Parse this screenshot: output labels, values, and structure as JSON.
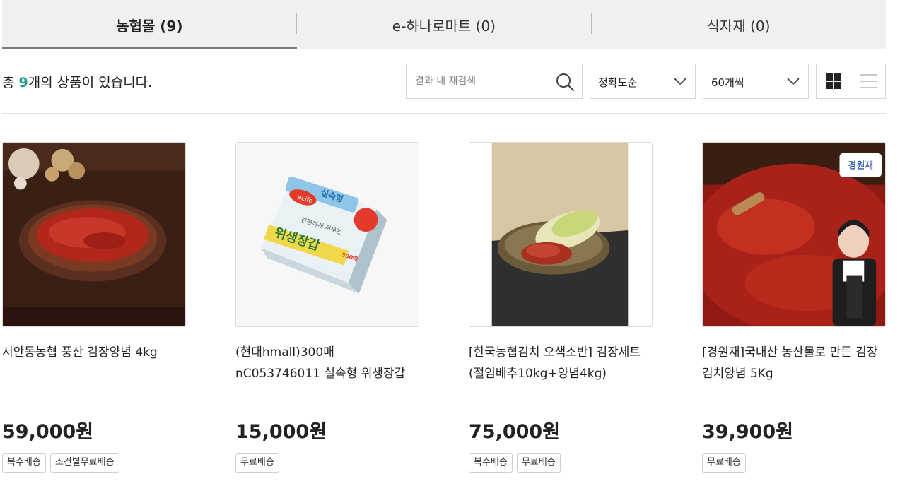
{
  "tabs": [
    {
      "label": "농협몰 (9)",
      "active": true
    },
    {
      "label": "e-하나로마트 (0)",
      "active": false
    },
    {
      "label": "식자재 (0)",
      "active": false
    }
  ],
  "result": {
    "prefix": "총 ",
    "count": "9",
    "suffix": "개의 상품이 있습니다."
  },
  "search": {
    "placeholder": "결과 내 재검색",
    "value": "",
    "icon": "search-icon"
  },
  "sort": {
    "selected": "정확도순",
    "icon": "chevron-down-icon"
  },
  "per_page": {
    "selected": "60개씩",
    "icon": "chevron-down-icon"
  },
  "view": {
    "grid_icon": "grid-view-icon",
    "list_icon": "list-view-icon",
    "active": "grid"
  },
  "colors": {
    "accent": "#1e9b88",
    "tab_bg": "#f0f0f0",
    "tab_underline": "#7b7b7b"
  },
  "products": [
    {
      "name": "서안동농협 풍산 김장양념 4kg",
      "price": "59,000원",
      "badges": [
        "복수배송",
        "조건별무료배송"
      ]
    },
    {
      "name": "(현대hmall)300매 nC053746011 실속형 위생장갑",
      "price": "15,000원",
      "badges": [
        "무료배송"
      ]
    },
    {
      "name": "[한국농협김치 오색소반] 김장세트(절임배추10kg+양념4kg)",
      "price": "75,000원",
      "badges": [
        "복수배송",
        "무료배송"
      ]
    },
    {
      "name": "[경원재]국내산 농산물로 만든 김장 김치양념 5Kg",
      "price": "39,900원",
      "badges": [
        "무료배송"
      ]
    }
  ],
  "image_text": {
    "p2_brand": "eLife",
    "p2_title": "위생장갑",
    "p2_line1": "실속형",
    "p2_line2": "간편하게 끼우는",
    "p2_count": "300매",
    "p4_logo": "경원재"
  }
}
